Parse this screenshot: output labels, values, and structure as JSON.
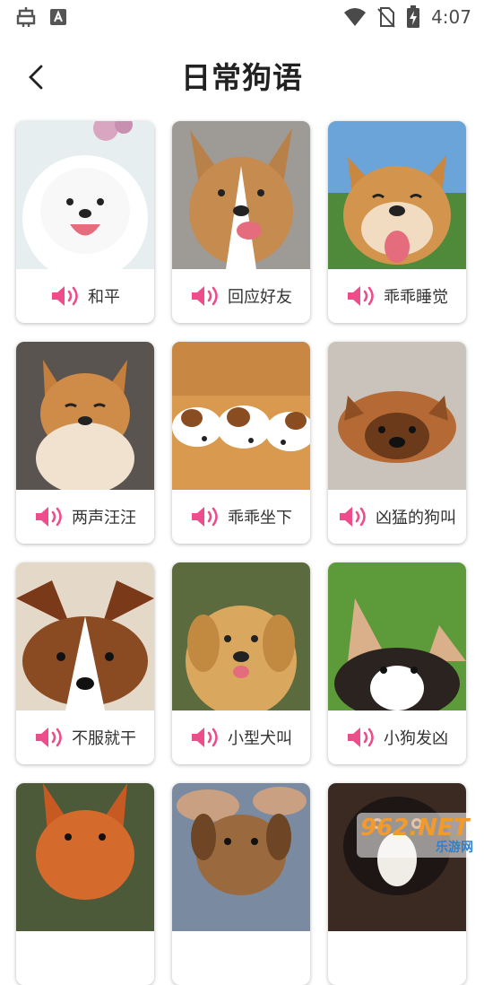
{
  "status_bar": {
    "time": "4:07",
    "left_icons": [
      "bug-icon",
      "text-a-icon"
    ],
    "right_icons": [
      "wifi-icon",
      "no-sim-icon",
      "battery-charging-icon"
    ]
  },
  "header": {
    "title": "日常狗语",
    "back_icon": "back-arrow-icon"
  },
  "accent_color": "#ee4d8b",
  "cards": [
    {
      "label": "和平",
      "photo": "white-samoyed-puppy"
    },
    {
      "label": "回应好友",
      "photo": "corgi-smiling"
    },
    {
      "label": "乖乖睡觉",
      "photo": "shiba-smiling-grass"
    },
    {
      "label": "两声汪汪",
      "photo": "shiba-eyes-closed"
    },
    {
      "label": "乖乖坐下",
      "photo": "three-puppies-sleeping"
    },
    {
      "label": "凶猛的狗叫",
      "photo": "pug-mix-lying"
    },
    {
      "label": "不服就干",
      "photo": "corgi-lying-down"
    },
    {
      "label": "小型犬叫",
      "photo": "golden-retriever"
    },
    {
      "label": "小狗发凶",
      "photo": "corgi-ears-up"
    },
    {
      "label": "",
      "photo": "fox-like-dog"
    },
    {
      "label": "",
      "photo": "brown-puppy-held"
    },
    {
      "label": "",
      "photo": "black-tan-dog"
    }
  ],
  "watermark": {
    "top": "962.NET",
    "bottom": "乐游网"
  }
}
